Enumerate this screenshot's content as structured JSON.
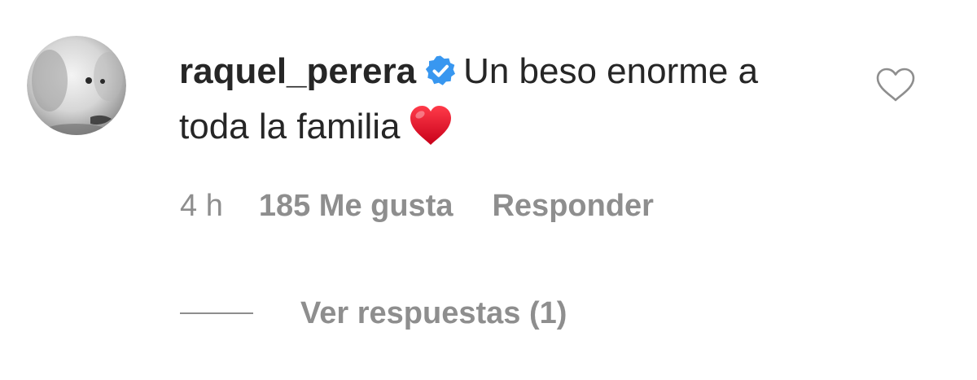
{
  "comment": {
    "username": "raquel_perera",
    "verified": true,
    "text": "Un beso enorme a toda la familia",
    "emoji": "red-heart",
    "time": "4 h",
    "likes": "185 Me gusta",
    "reply_label": "Responder",
    "liked": false
  },
  "replies": {
    "label": "Ver respuestas (1)"
  },
  "colors": {
    "text": "#262626",
    "secondary": "#8e8e8e",
    "verified_badge": "#3897f0",
    "heart_emoji": "#e0102a"
  },
  "icons": {
    "avatar": "avatar-image",
    "verified": "verified-badge-icon",
    "like": "heart-outline-icon"
  }
}
